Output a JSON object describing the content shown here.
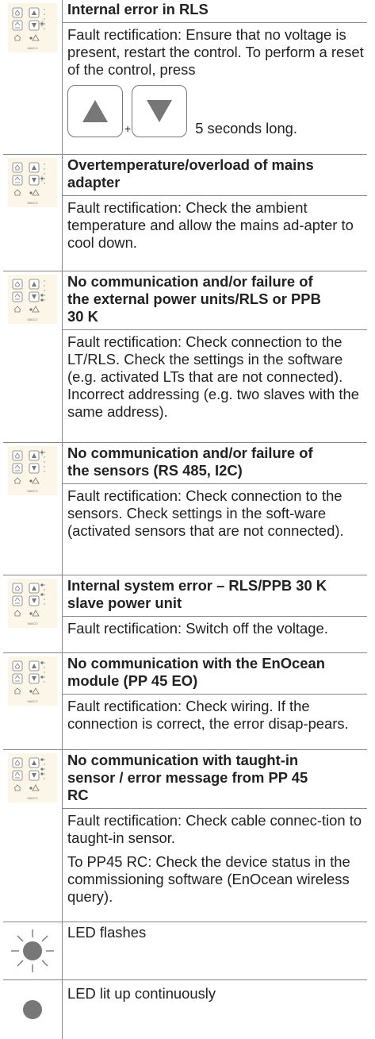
{
  "entries": [
    {
      "title_lines": [
        "Internal error in RLS"
      ],
      "paragraphs": [
        "Fault rectification: Ensure that no voltage is present, restart the control. To perform a reset of the control, press"
      ],
      "plus": "+",
      "duration": "5 seconds long."
    },
    {
      "title_lines": [
        "Overtemperature/overload of mains",
        "adapter"
      ],
      "paragraphs": [
        "Fault rectification: Check the ambient temperature and allow the mains ad-apter to cool down."
      ]
    },
    {
      "title_lines": [
        "No communication and/or failure of",
        "the external power units/RLS or PPB",
        "30 K"
      ],
      "paragraphs": [
        "Fault rectification: Check connection to the LT/RLS. Check the settings in the software (e.g. activated LTs that are not connected). Incorrect addressing (e.g. two slaves with the same address)."
      ]
    },
    {
      "title_lines": [
        "No communication and/or failure of",
        "the sensors (RS 485, I2C)"
      ],
      "paragraphs": [
        "Fault rectification: Check connection to the sensors. Check settings in the soft-ware (activated sensors that are not connected)."
      ]
    },
    {
      "title_lines": [
        "Internal system error – RLS/PPB 30 K",
        "slave power unit"
      ],
      "paragraphs": [
        "Fault rectification: Switch off the voltage."
      ]
    },
    {
      "title_lines": [
        "No communication with the EnOcean",
        "module (PP 45 EO)"
      ],
      "paragraphs": [
        "Fault rectification: Check wiring. If the connection is correct, the error disap-pears."
      ]
    },
    {
      "title_lines": [
        "No communication with taught-in",
        "sensor / error message from PP 45",
        "RC"
      ],
      "paragraphs": [
        "Fault rectification: Check cable connec-tion to taught-in sensor.",
        "To PP45 RC: Check the device status in the commissioning software (EnOcean wireless query)."
      ]
    }
  ],
  "device_brand": "MAICO",
  "legend": {
    "flash": "LED flashes",
    "steady": "LED lit up continuously"
  },
  "colors": {
    "panel_bg": "#fbf6e7",
    "border": "#888888",
    "led": "#777777",
    "key_arrow": "#777777"
  }
}
